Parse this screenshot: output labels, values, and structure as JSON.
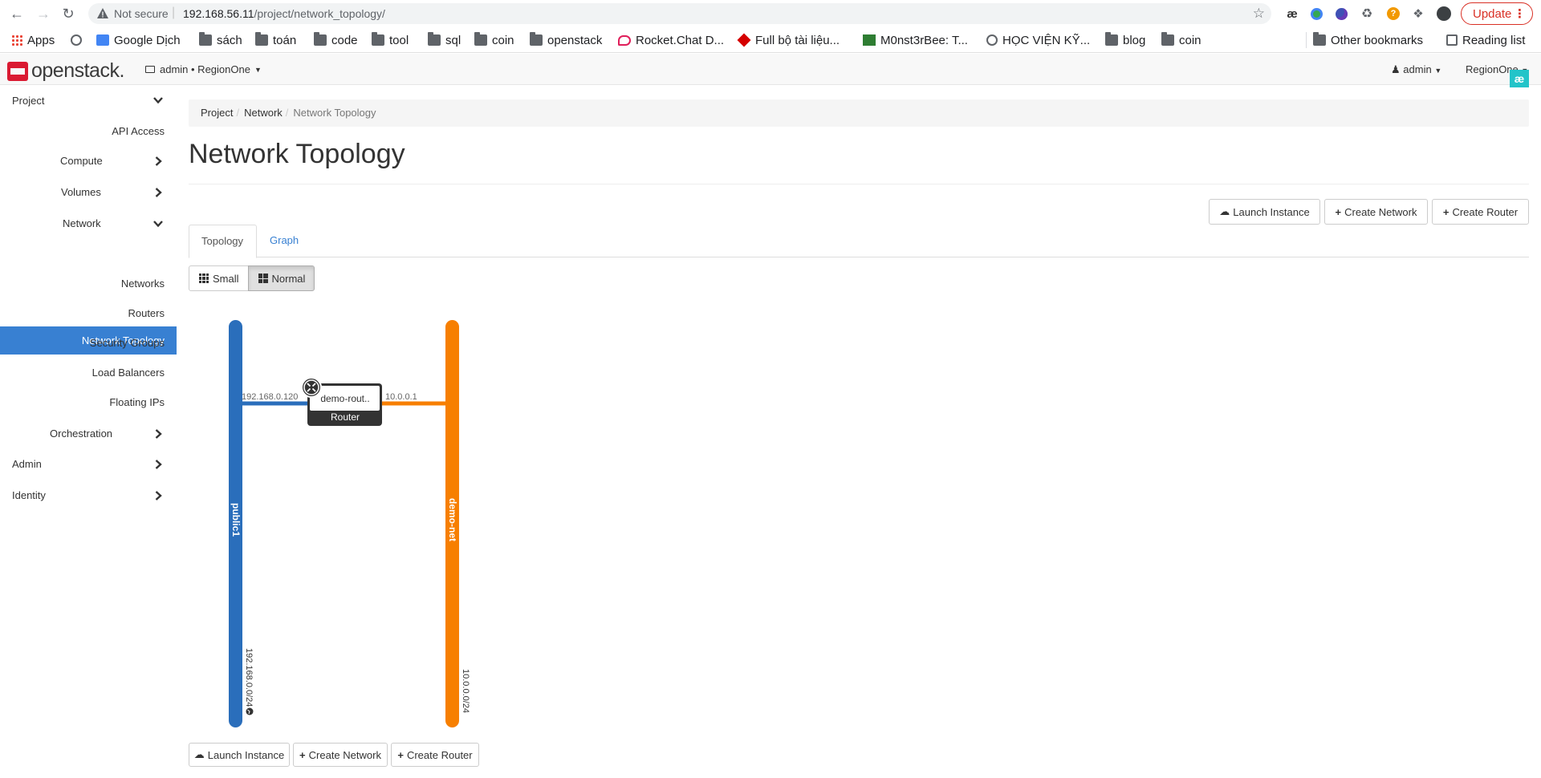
{
  "browser": {
    "security_label": "Not secure",
    "url_host": "192.168.56.11",
    "url_path": "/project/network_topology/",
    "update_label": "Update",
    "bookmarks": [
      {
        "label": "Apps",
        "icon": "apps-grid-icon"
      },
      {
        "label": "",
        "icon": "globe-icon"
      },
      {
        "label": "Google Dịch",
        "icon": "google-translate-icon"
      },
      {
        "label": "sách",
        "icon": "folder-icon"
      },
      {
        "label": "toán",
        "icon": "folder-icon"
      },
      {
        "label": "code",
        "icon": "folder-icon"
      },
      {
        "label": "tool",
        "icon": "folder-icon"
      },
      {
        "label": "sql",
        "icon": "folder-icon"
      },
      {
        "label": "coin",
        "icon": "folder-icon"
      },
      {
        "label": "openstack",
        "icon": "folder-icon"
      },
      {
        "label": "Rocket.Chat D...",
        "icon": "rocketchat-icon"
      },
      {
        "label": "Full bộ tài liệu...",
        "icon": "red-diamond-icon"
      },
      {
        "label": "M0nst3rBee: T...",
        "icon": "green-chart-icon"
      },
      {
        "label": "HỌC VIỆN KỸ...",
        "icon": "globe-icon"
      },
      {
        "label": "blog",
        "icon": "folder-icon"
      },
      {
        "label": "coin",
        "icon": "folder-icon"
      }
    ],
    "other_bookmarks": "Other bookmarks",
    "reading_list": "Reading list"
  },
  "header": {
    "logo_text": "openstack.",
    "project_selector": "admin • RegionOne",
    "user_menu": "admin",
    "region_menu": "RegionOne"
  },
  "sidebar": {
    "project": "Project",
    "api_access": "API Access",
    "compute": "Compute",
    "volumes": "Volumes",
    "network": "Network",
    "network_topology": "Network Topology",
    "networks": "Networks",
    "routers": "Routers",
    "security_groups": "Security Groups",
    "load_balancers": "Load Balancers",
    "floating_ips": "Floating IPs",
    "orchestration": "Orchestration",
    "admin": "Admin",
    "identity": "Identity"
  },
  "breadcrumb": [
    "Project",
    "Network",
    "Network Topology"
  ],
  "page_title": "Network Topology",
  "actions": {
    "launch_instance": "Launch Instance",
    "create_network": "Create Network",
    "create_router": "Create Router"
  },
  "tabs": [
    "Topology",
    "Graph"
  ],
  "size_toggle": {
    "small": "Small",
    "normal": "Normal",
    "selected": "Normal"
  },
  "topology": {
    "networks": [
      {
        "name": "public1",
        "cidr": "192.168.0.0/24",
        "color": "#2a6ebb",
        "external": true
      },
      {
        "name": "demo-net",
        "cidr": "10.0.0.0/24",
        "color": "#f77f00",
        "external": false
      }
    ],
    "router": {
      "name": "demo-rout..",
      "type_label": "Router"
    },
    "ports": [
      {
        "ip": "192.168.0.120",
        "network": "public1"
      },
      {
        "ip": "10.0.0.1",
        "network": "demo-net"
      }
    ]
  }
}
